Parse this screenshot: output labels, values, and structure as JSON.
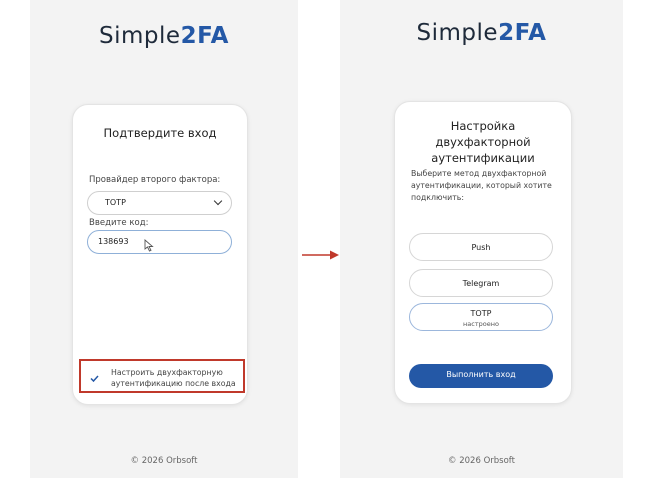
{
  "brand": {
    "prefix": "Simple",
    "suffix": "2FA",
    "accent_color": "#2458a6"
  },
  "login_screen": {
    "title": "Подтвердите вход",
    "provider_label": "Провайдер второго фактора:",
    "provider_value": "TOTP",
    "code_label": "Введите код:",
    "code_value": "138693",
    "setup_checkbox_label": "Настроить двухфакторную аутентификацию после входа",
    "setup_checkbox_checked": true,
    "highlight_color": "#c0392b",
    "footer": "© 2026 Orbsoft"
  },
  "setup_screen": {
    "title": "Настройка двухфакторной аутентификации",
    "description": "Выберите метод двухфакторной аутентификации, который хотите подключить:",
    "methods": [
      {
        "label": "Push"
      },
      {
        "label": "Telegram"
      },
      {
        "label": "TOTP",
        "status": "настроено"
      }
    ],
    "submit_label": "Выполнить вход",
    "footer": "© 2026 Orbsoft"
  },
  "arrow_color": "#c0392b"
}
